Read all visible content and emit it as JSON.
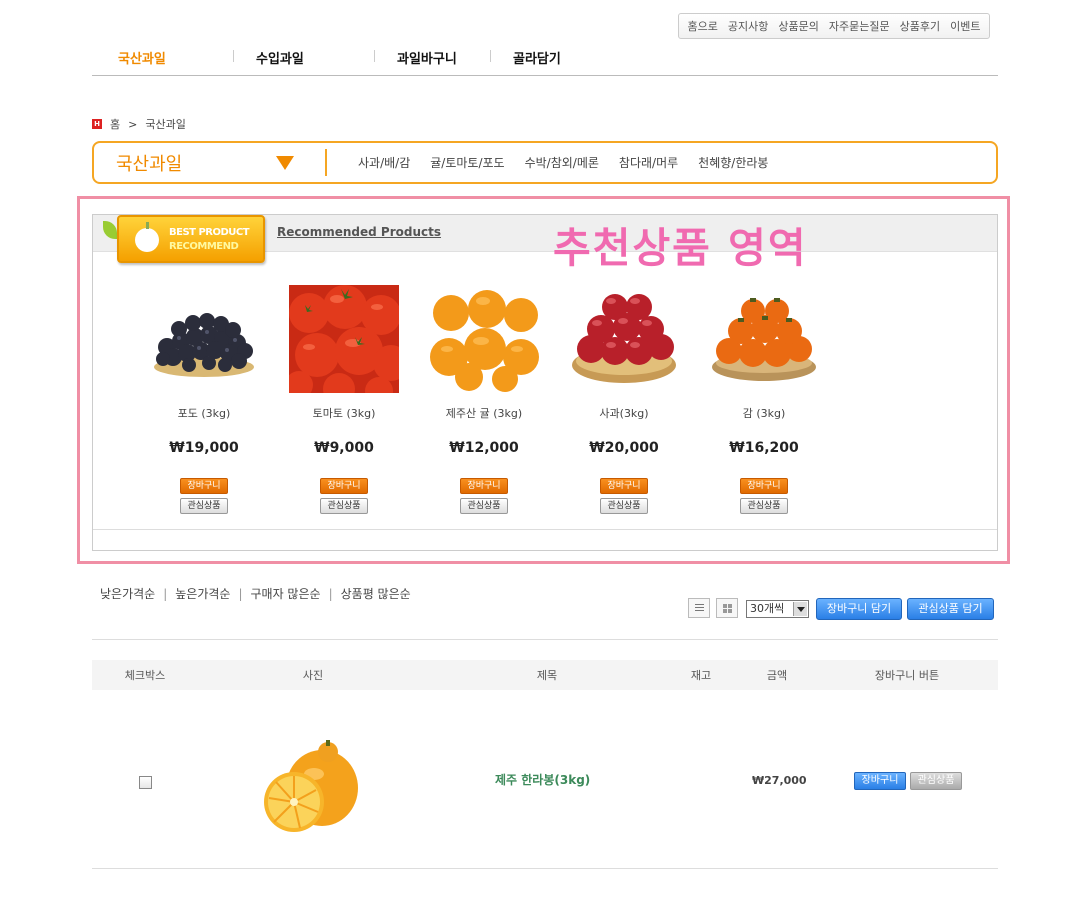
{
  "util_links": [
    "홈으로",
    "공지사항",
    "상품문의",
    "자주묻는질문",
    "상품후기",
    "이벤트"
  ],
  "gnb": [
    {
      "label": "국산과일",
      "active": true
    },
    {
      "label": "수입과일",
      "active": false
    },
    {
      "label": "과일바구니",
      "active": false
    },
    {
      "label": "골라담기",
      "active": false
    }
  ],
  "breadcrumb": {
    "home": "홈",
    "current": "국산과일"
  },
  "category": {
    "current": "국산과일",
    "subs": [
      "사과/배/감",
      "귤/토마토/포도",
      "수박/참외/메론",
      "참다래/머루",
      "천혜향/한라봉"
    ]
  },
  "recommended": {
    "badge_line1": "BEST PRODUCT",
    "badge_line2": "RECOMMEND",
    "title": "Recommended Products",
    "overlay_label": "추천상품 영역",
    "cart_label": "장바구니",
    "wish_label": "관심상품",
    "products": [
      {
        "name": "포도 (3kg)",
        "price": "₩19,000",
        "icon": "grapes"
      },
      {
        "name": "토마토 (3kg)",
        "price": "₩9,000",
        "icon": "tomato"
      },
      {
        "name": "제주산 귤 (3kg)",
        "price": "₩12,000",
        "icon": "tangerine"
      },
      {
        "name": "사과(3kg)",
        "price": "₩20,000",
        "icon": "apple"
      },
      {
        "name": "감 (3kg)",
        "price": "₩16,200",
        "icon": "persimmon"
      }
    ]
  },
  "sort_options": [
    "낮은가격순",
    "높은가격순",
    "구매자 많은순",
    "상품평 많은순"
  ],
  "list_tools": {
    "per_page": "30개씩",
    "add_cart": "장바구니 담기",
    "add_wish": "관심상품 담기"
  },
  "table": {
    "headers": [
      "체크박스",
      "사진",
      "제목",
      "재고",
      "금액",
      "장바구니 버튼"
    ],
    "rows": [
      {
        "title": "제주 한라봉(3kg)",
        "price": "₩27,000",
        "cart": "장바구니",
        "wish": "관심상품"
      }
    ]
  },
  "colors": {
    "accent": "#f08a00",
    "overlay": "#f06ab0",
    "frame": "#f08fa5",
    "blue": "#2a7fe6"
  }
}
